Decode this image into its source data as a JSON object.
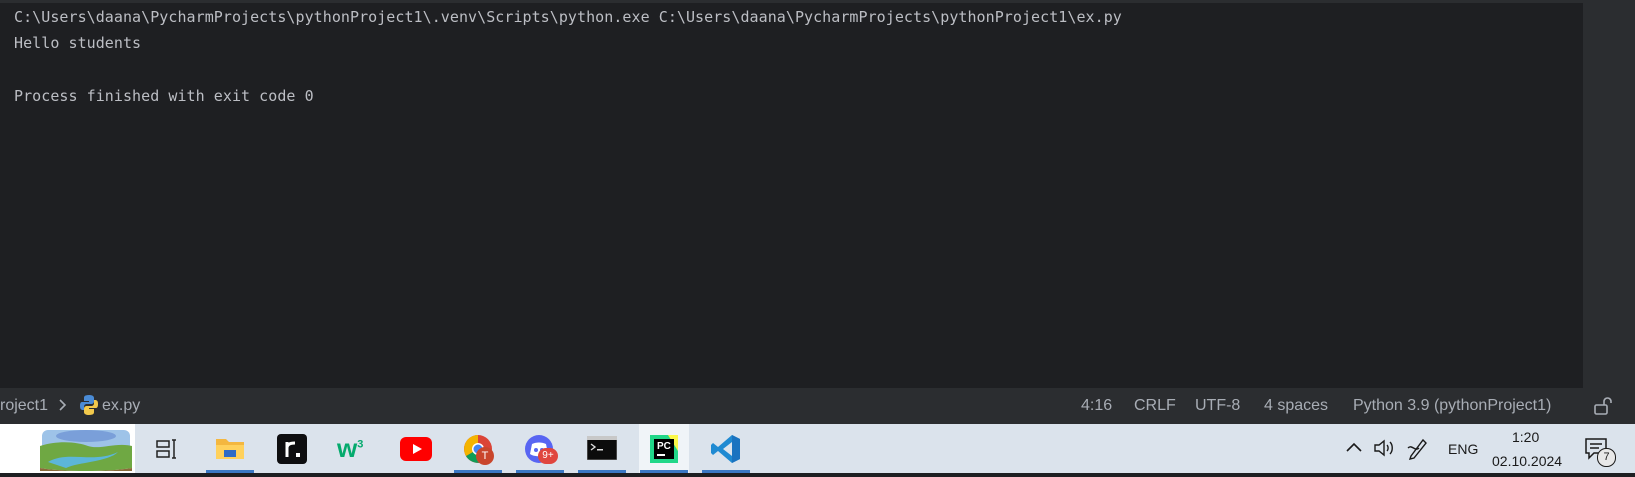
{
  "console": {
    "lines": [
      "C:\\Users\\daana\\PycharmProjects\\pythonProject1\\.venv\\Scripts\\python.exe C:\\Users\\daana\\PycharmProjects\\pythonProject1\\ex.py",
      "Hello students",
      "",
      "Process finished with exit code 0"
    ]
  },
  "statusbar": {
    "breadcrumb_project": "roject1",
    "breadcrumb_file": "ex.py",
    "position": "4:16",
    "line_separator": "CRLF",
    "encoding": "UTF-8",
    "indent": "4 spaces",
    "interpreter": "Python 3.9 (pythonProject1)"
  },
  "taskbar": {
    "apps": [
      {
        "icon": "task-view-icon"
      },
      {
        "icon": "file-explorer-icon"
      },
      {
        "icon": "replit-icon"
      },
      {
        "icon": "w3schools-icon",
        "label": "w",
        "sup": "3"
      },
      {
        "icon": "youtube-icon"
      },
      {
        "icon": "chrome-icon",
        "badge": "T"
      },
      {
        "icon": "discord-icon",
        "badge": "9+"
      },
      {
        "icon": "terminal-icon"
      },
      {
        "icon": "pycharm-icon",
        "label": "PC"
      },
      {
        "icon": "vscode-icon"
      }
    ],
    "tray": {
      "language": "ENG",
      "time": "1:20",
      "date": "02.10.2024",
      "notification_count": "7"
    }
  },
  "colors": {
    "editor_bg": "#1e1f22",
    "statusbar_bg": "#2b2d30",
    "taskbar_bg": "#dbe3ec",
    "accent": "#3b78c4"
  }
}
